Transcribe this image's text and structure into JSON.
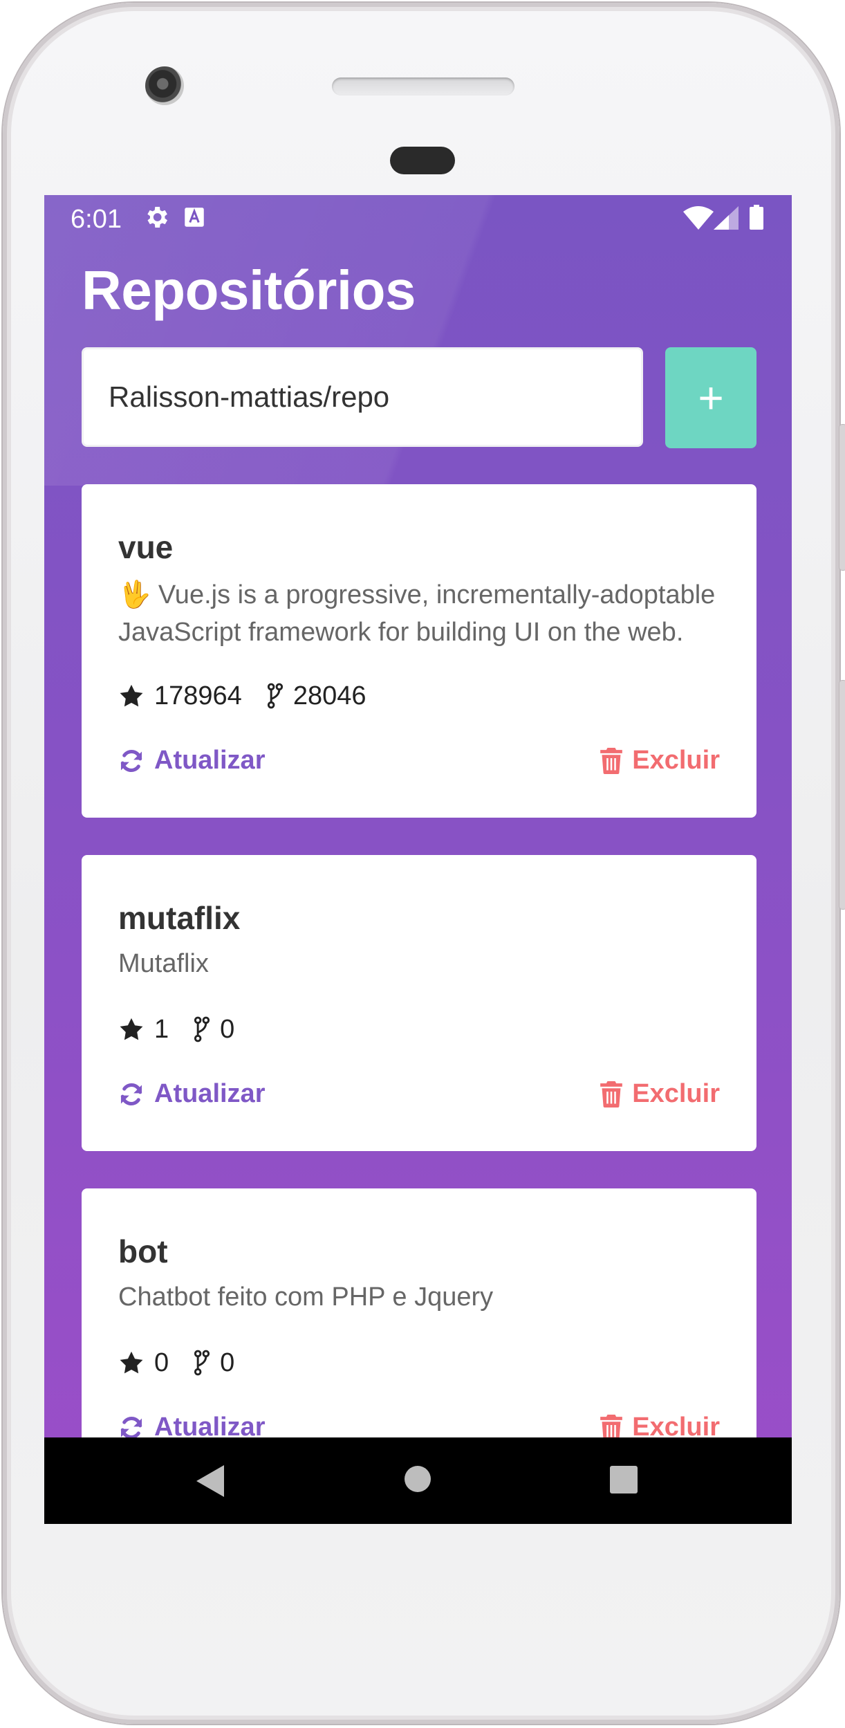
{
  "status_bar": {
    "time": "6:01",
    "icons": [
      "gear-icon",
      "text-a-icon",
      "wifi-icon",
      "signal-icon",
      "battery-icon"
    ]
  },
  "header": {
    "title": "Repositórios"
  },
  "search": {
    "value": "Ralisson-mattias/repo",
    "add_label": "+"
  },
  "repositories": [
    {
      "title": "vue",
      "description": "🖖 Vue.js is a progressive, incrementally-adoptable JavaScript framework for building UI on the web.",
      "stars": "178964",
      "forks": "28046",
      "update_label": "Atualizar",
      "delete_label": "Excluir"
    },
    {
      "title": "mutaflix",
      "description": "Mutaflix",
      "stars": "1",
      "forks": "0",
      "update_label": "Atualizar",
      "delete_label": "Excluir"
    },
    {
      "title": "bot",
      "description": "Chatbot feito com PHP e Jquery",
      "stars": "0",
      "forks": "0",
      "update_label": "Atualizar",
      "delete_label": "Excluir"
    }
  ],
  "colors": {
    "background_top": "#7a55c3",
    "background_bottom": "#9b4ec8",
    "add_button": "#6ed6c2",
    "update_action": "#7f58c6",
    "delete_action": "#f26c70"
  },
  "nav_bar": {
    "icons": [
      "back-icon",
      "home-icon",
      "recents-icon"
    ]
  }
}
